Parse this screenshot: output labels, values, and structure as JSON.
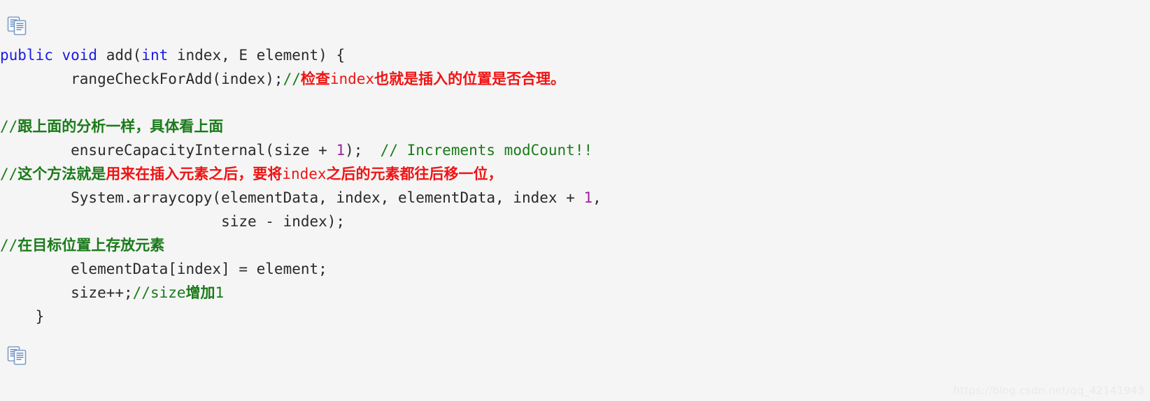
{
  "background_color": "#f5f5f5",
  "colors": {
    "plain": "#2a2a2a",
    "keyword": "#1a1ae6",
    "number": "#a020a0",
    "comment_green": "#1a7a1a",
    "comment_red": "#f01414",
    "watermark": "#eaeaea"
  },
  "icons": {
    "copy_top": "copy-icon",
    "copy_bottom": "copy-icon"
  },
  "code": {
    "language": "java",
    "lines": [
      {
        "id": "line-1",
        "segments": [
          {
            "text": "public void ",
            "type": "keyword"
          },
          {
            "text": "add(",
            "type": "plain"
          },
          {
            "text": "int",
            "type": "keyword"
          },
          {
            "text": " index, E element) {",
            "type": "plain"
          }
        ],
        "plain_text": "public void add(int index, E element) {"
      },
      {
        "id": "line-2",
        "segments": [
          {
            "text": "        rangeCheckForAdd(index);",
            "type": "plain"
          },
          {
            "text": "//",
            "type": "comment"
          },
          {
            "text": "检查",
            "type": "red-cjk"
          },
          {
            "text": "index",
            "type": "red"
          },
          {
            "text": "也就是插入的位置是否合理。",
            "type": "red-cjk"
          }
        ],
        "plain_text": "        rangeCheckForAdd(index);//检查index也就是插入的位置是否合理。"
      },
      {
        "id": "line-3",
        "segments": [],
        "plain_text": ""
      },
      {
        "id": "line-4",
        "segments": [
          {
            "text": "//",
            "type": "comment"
          },
          {
            "text": "跟上面的分析一样，具体看上面",
            "type": "comment-cjk"
          }
        ],
        "plain_text": "//跟上面的分析一样，具体看上面"
      },
      {
        "id": "line-5",
        "segments": [
          {
            "text": "        ensureCapacityInternal(size + ",
            "type": "plain"
          },
          {
            "text": "1",
            "type": "number"
          },
          {
            "text": ");  ",
            "type": "plain"
          },
          {
            "text": "// Increments modCount!!",
            "type": "comment"
          }
        ],
        "plain_text": "        ensureCapacityInternal(size + 1);  // Increments modCount!!"
      },
      {
        "id": "line-6",
        "segments": [
          {
            "text": "//",
            "type": "comment"
          },
          {
            "text": "这个方法就是",
            "type": "comment-cjk"
          },
          {
            "text": "用来在插入元素之后，要将",
            "type": "red-cjk"
          },
          {
            "text": "index",
            "type": "red"
          },
          {
            "text": "之后的元素都往后移一位，",
            "type": "red-cjk"
          }
        ],
        "plain_text": "//这个方法就是用来在插入元素之后，要将index之后的元素都往后移一位，"
      },
      {
        "id": "line-7",
        "segments": [
          {
            "text": "        System.arraycopy(elementData, index, elementData, index + ",
            "type": "plain"
          },
          {
            "text": "1",
            "type": "number"
          },
          {
            "text": ",",
            "type": "plain"
          }
        ],
        "plain_text": "        System.arraycopy(elementData, index, elementData, index + 1,"
      },
      {
        "id": "line-8",
        "segments": [
          {
            "text": "                         size - index);",
            "type": "plain"
          }
        ],
        "plain_text": "                         size - index);"
      },
      {
        "id": "line-9",
        "segments": [
          {
            "text": "//",
            "type": "comment"
          },
          {
            "text": "在目标位置上存放元素",
            "type": "comment-cjk"
          }
        ],
        "plain_text": "//在目标位置上存放元素"
      },
      {
        "id": "line-10",
        "segments": [
          {
            "text": "        elementData[index] = element;",
            "type": "plain"
          }
        ],
        "plain_text": "        elementData[index] = element;"
      },
      {
        "id": "line-11",
        "segments": [
          {
            "text": "        size++;",
            "type": "plain"
          },
          {
            "text": "//size",
            "type": "comment"
          },
          {
            "text": "增加",
            "type": "comment-cjk"
          },
          {
            "text": "1",
            "type": "comment"
          }
        ],
        "plain_text": "        size++;//size增加1"
      },
      {
        "id": "line-12",
        "segments": [
          {
            "text": "    }",
            "type": "plain"
          }
        ],
        "plain_text": "    }"
      }
    ]
  },
  "watermark": {
    "text": "https://blog.csdn.net/qq_42141943"
  }
}
